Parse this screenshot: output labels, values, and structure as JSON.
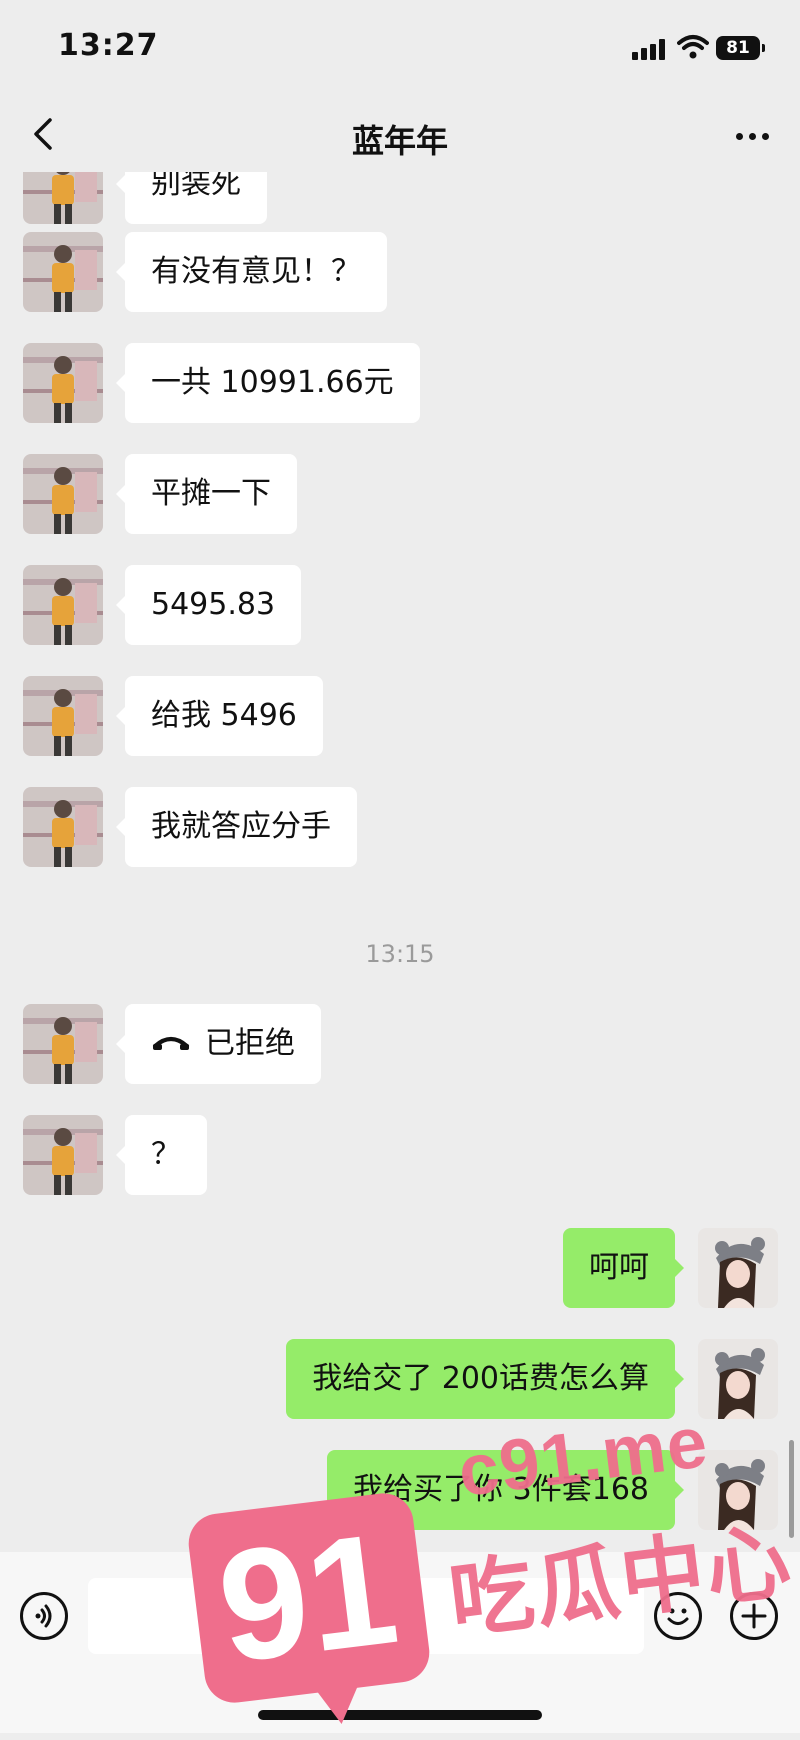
{
  "status_bar": {
    "time": "13:27",
    "battery": "81"
  },
  "header": {
    "title": "蓝年年"
  },
  "messages": [
    {
      "side": "left",
      "text": "别装死"
    },
    {
      "side": "left",
      "text": "有没有意见！？"
    },
    {
      "side": "left",
      "text": "一共 10991.66元"
    },
    {
      "side": "left",
      "text": "平摊一下"
    },
    {
      "side": "left",
      "text": "5495.83"
    },
    {
      "side": "left",
      "text": "给我 5496"
    },
    {
      "side": "left",
      "text": "我就答应分手"
    },
    {
      "side": "left",
      "text": "已拒绝"
    },
    {
      "side": "left",
      "text": "？"
    },
    {
      "side": "right",
      "text": "呵呵"
    },
    {
      "side": "right",
      "text": "我给交了 200话费怎么算"
    },
    {
      "side": "right",
      "text": "我给买了你 3件套168"
    }
  ],
  "timestamp": "13:15",
  "watermark": {
    "number": "91",
    "domain": "c91.me",
    "label": "吃瓜中心"
  },
  "colors": {
    "background": "#ededed",
    "self_bubble": "#95ec69",
    "other_bubble": "#ffffff",
    "watermark": "#ef6e8c"
  },
  "icons": {
    "back": "chevron-left-icon",
    "more": "more-dots-icon",
    "voice": "voice-icon",
    "emoji": "emoji-icon",
    "plus": "plus-icon",
    "call": "phone-hangup-icon"
  }
}
